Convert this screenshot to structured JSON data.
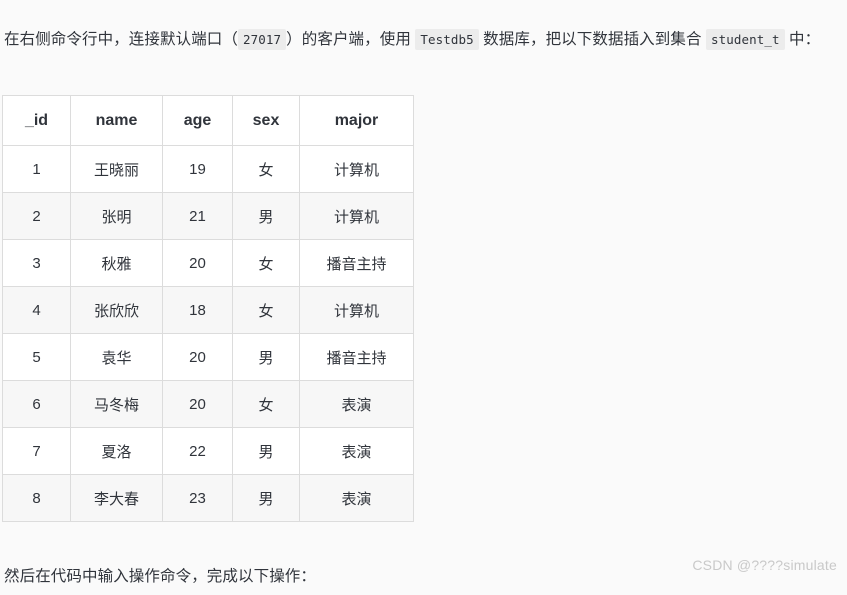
{
  "intro": {
    "seg1": "在右侧命令行中，连接默认端口（",
    "code_port": "27017",
    "seg2": "）的客户端，使用 ",
    "code_db": "Testdb5",
    "seg3": " 数据库，把以下数据插入到集合 ",
    "code_collection": "student_t",
    "seg4": " 中："
  },
  "table": {
    "columns": [
      "_id",
      "name",
      "age",
      "sex",
      "major"
    ],
    "rows": [
      {
        "_id": "1",
        "name": "王晓丽",
        "age": "19",
        "sex": "女",
        "major": "计算机"
      },
      {
        "_id": "2",
        "name": "张明",
        "age": "21",
        "sex": "男",
        "major": "计算机"
      },
      {
        "_id": "3",
        "name": "秋雅",
        "age": "20",
        "sex": "女",
        "major": "播音主持"
      },
      {
        "_id": "4",
        "name": "张欣欣",
        "age": "18",
        "sex": "女",
        "major": "计算机"
      },
      {
        "_id": "5",
        "name": "袁华",
        "age": "20",
        "sex": "男",
        "major": "播音主持"
      },
      {
        "_id": "6",
        "name": "马冬梅",
        "age": "20",
        "sex": "女",
        "major": "表演"
      },
      {
        "_id": "7",
        "name": "夏洛",
        "age": "22",
        "sex": "男",
        "major": "表演"
      },
      {
        "_id": "8",
        "name": "李大春",
        "age": "23",
        "sex": "男",
        "major": "表演"
      }
    ]
  },
  "outro": {
    "text": "然后在代码中输入操作命令，完成以下操作："
  },
  "watermark": {
    "text": "CSDN @????simulate"
  },
  "colors": {
    "page_background": "#fafafa",
    "table_background": "#ffffff",
    "stripe_background": "#f7f7f7",
    "border": "#dcdcdc",
    "text": "#30343b",
    "code_background": "#ececec",
    "watermark": "#c9c9c9"
  }
}
